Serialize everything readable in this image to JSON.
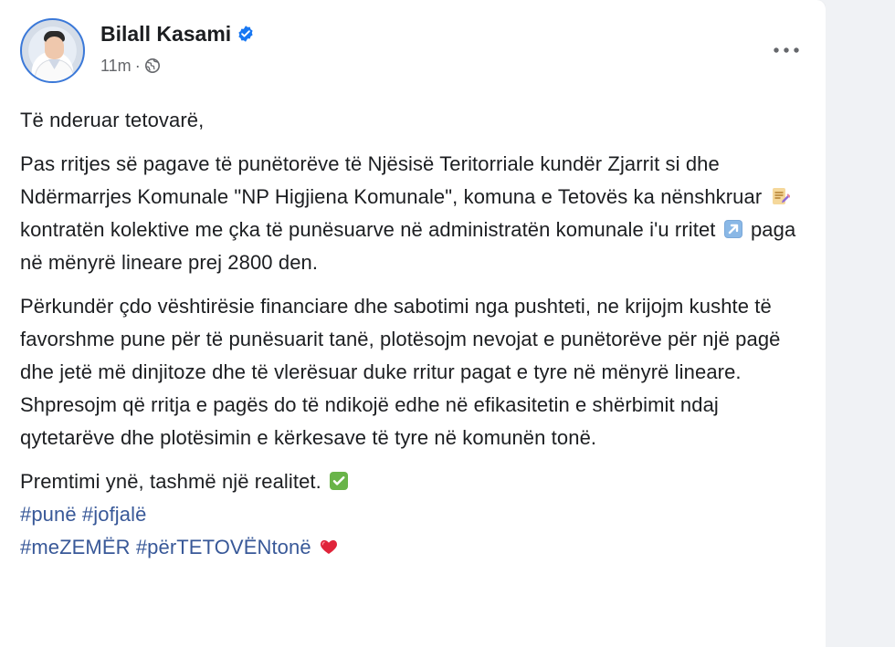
{
  "post": {
    "author": "Bilall Kasami",
    "timestamp": "11m",
    "meta_separator": "·",
    "paragraphs": {
      "greeting": "Të nderuar tetovarë,",
      "p1_part1": "Pas rritjes së pagave të punëtorëve të Njësisë Teritorriale kundër Zjarrit si dhe Ndërmarrjes Komunale \"NP Higjiena Komunale\", komuna e Tetovës ka nënshkruar",
      "p1_part2": "kontratën kolektive me çka të punësuarve në administratën komunale i'u rritet",
      "p1_part3": "paga në mënyrë lineare prej 2800 den.",
      "p2": "Përkundër çdo vështirësie financiare dhe sabotimi nga pushteti, ne krijojm kushte të favorshme pune për të punësuarit tanë, plotësojm nevojat e punëtorëve për një pagë dhe jetë më dinjitoze dhe të vlerësuar duke rritur pagat e tyre në mënyrë lineare. Shpresojm që rritja e pagës do të ndikojë edhe në efikasitetin e shërbimit ndaj qytetarëve dhe plotësimin e kërkesave të tyre në komunën tonë.",
      "p3": "Premtimi ynë, tashmë një realitet."
    },
    "hashtags": {
      "line1": [
        "#punë",
        "#jofjalë"
      ],
      "line2": [
        "#meZEMËR",
        "#përTETOVËNtonë"
      ]
    },
    "icons": {
      "verified": "verified-badge-icon",
      "visibility": "globe-icon",
      "more": "more-options-icon",
      "writing": "memo-emoji",
      "increase": "up-right-arrow-emoji",
      "check": "check-mark-emoji",
      "heart": "red-heart-emoji"
    },
    "colors": {
      "link": "#385898",
      "verified": "#1877f2",
      "meta": "#65676b"
    }
  }
}
